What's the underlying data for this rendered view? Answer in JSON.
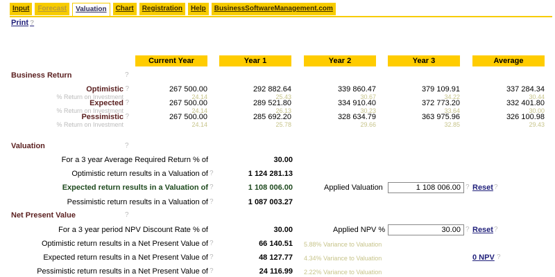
{
  "tabs": [
    {
      "label": "Input"
    },
    {
      "label": "Forecast"
    },
    {
      "label": "Valuation"
    },
    {
      "label": "Chart"
    },
    {
      "label": "Registration"
    },
    {
      "label": "Help"
    },
    {
      "label": "BusinessSoftwareManagement.com"
    }
  ],
  "print_label": "Print",
  "help_mark": "?",
  "columns": [
    "Current Year",
    "Year 1",
    "Year 2",
    "Year 3",
    "Average"
  ],
  "business_return": {
    "title": "Business Return",
    "rows": [
      {
        "label": "Optimistic",
        "sub": "% Return on Investment",
        "values": [
          "267 500.00",
          "292 882.64",
          "339 860.47",
          "379 109.91",
          "337 284.34"
        ],
        "pcts": [
          "24.14",
          "25.43",
          "30.67",
          "34.22",
          "30.44"
        ]
      },
      {
        "label": "Expected",
        "sub": "% Return on Investment",
        "values": [
          "267 500.00",
          "289 521.80",
          "334 910.40",
          "372 773.20",
          "332 401.80"
        ],
        "pcts": [
          "24.14",
          "26.13",
          "30.23",
          "33.64",
          "30.00"
        ]
      },
      {
        "label": "Pessimistic",
        "sub": "% Return on Investment",
        "values": [
          "267 500.00",
          "285 692.20",
          "328 634.79",
          "363 975.96",
          "326 100.98"
        ],
        "pcts": [
          "24.14",
          "25.78",
          "29.66",
          "32.85",
          "29.43"
        ]
      }
    ]
  },
  "valuation": {
    "title": "Valuation",
    "required_return_label": "For a 3 year Average Required Return % of",
    "required_return_value": "30.00",
    "optimistic_label": "Optimistic return results in a Valuation of",
    "optimistic_value": "1 124 281.13",
    "expected_label": "Expected return results in a Valuation of",
    "expected_value": "1 108 006.00",
    "pessimistic_label": "Pessimistic return results in a Valuation of",
    "pessimistic_value": "1 087 003.27",
    "applied_label": "Applied Valuation",
    "applied_value": "1 108 006.00",
    "reset_label": "Reset"
  },
  "npv": {
    "title": "Net Present Value",
    "rate_label": "For a 3 year period NPV Discount Rate % of",
    "rate_value": "30.00",
    "applied_label": "Applied NPV %",
    "applied_value": "30.00",
    "reset_label": "Reset",
    "optimistic_label": "Optimistic return results in a Net Present Value of",
    "optimistic_value": "66 140.51",
    "optimistic_var": "5.88% Variance to Valuation",
    "expected_label": "Expected return results in a Net Present Value of",
    "expected_value": "48 127.77",
    "expected_var": "4.34% Variance to Valuation",
    "zero_npv_label": "0 NPV",
    "pessimistic_label": "Pessimistic return results in a Net Present Value of",
    "pessimistic_value": "24 116.99",
    "pessimistic_var": "2.22% Variance to Valuation"
  }
}
